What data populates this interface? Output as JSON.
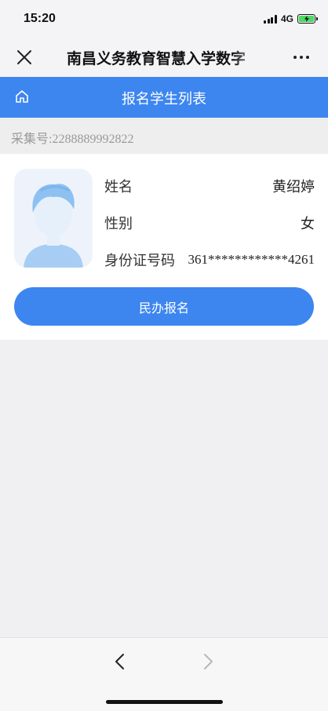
{
  "status_bar": {
    "time": "15:20",
    "network": "4G",
    "icons": [
      "signal-icon",
      "battery-charging-icon"
    ]
  },
  "nav_bar": {
    "title": "南昌义务教育智慧入学数字",
    "icons": [
      "close-icon",
      "more-icon"
    ]
  },
  "header": {
    "title": "报名学生列表",
    "icon": "home-icon",
    "color": "#3d86f0"
  },
  "collection": {
    "text": "采集号:2288889992822"
  },
  "student": {
    "avatar_icon": "student-avatar",
    "fields": [
      {
        "label": "姓名",
        "value": "黄绍婷"
      },
      {
        "label": "性别",
        "value": "女"
      },
      {
        "label": "身份证号码",
        "value": "361************4261"
      }
    ],
    "button_label": "民办报名"
  },
  "bottom_bar": {
    "icons": [
      "back-arrow-icon",
      "forward-arrow-icon"
    ]
  }
}
